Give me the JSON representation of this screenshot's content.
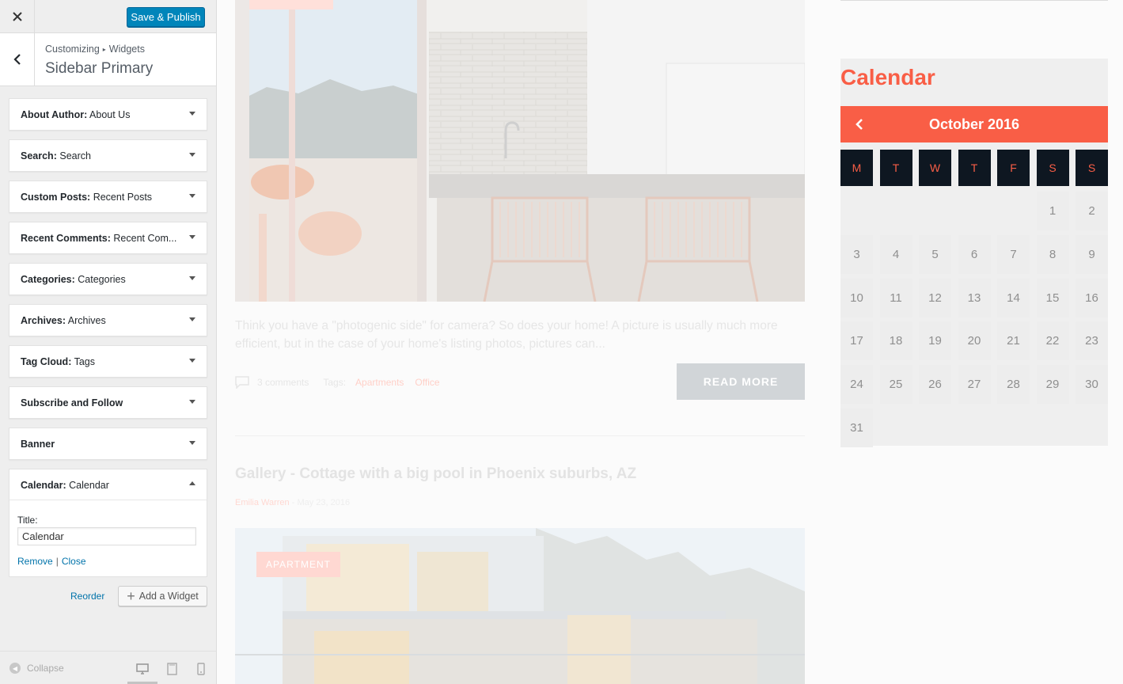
{
  "customizer": {
    "save_label": "Save & Publish",
    "breadcrumb": [
      "Customizing",
      "Widgets"
    ],
    "section_title": "Sidebar Primary",
    "widgets": [
      {
        "name": "About Author",
        "title": "About Us"
      },
      {
        "name": "Search",
        "title": "Search"
      },
      {
        "name": "Custom Posts",
        "title": "Recent Posts"
      },
      {
        "name": "Recent Comments",
        "title": "Recent Com..."
      },
      {
        "name": "Categories",
        "title": "Categories"
      },
      {
        "name": "Archives",
        "title": "Archives"
      },
      {
        "name": "Tag Cloud",
        "title": "Tags"
      },
      {
        "name": "Subscribe and Follow",
        "title": ""
      },
      {
        "name": "Banner",
        "title": ""
      },
      {
        "name": "Calendar",
        "title": "Calendar"
      }
    ],
    "open_widget": {
      "field_label": "Title:",
      "field_value": "Calendar",
      "remove_label": "Remove",
      "close_label": "Close"
    },
    "reorder_label": "Reorder",
    "add_widget_label": "Add a Widget",
    "collapse_label": "Collapse",
    "icons": [
      "close-icon",
      "back-arrow-icon",
      "chevron-down-icon",
      "chevron-up-icon",
      "plus-icon",
      "collapse-icon",
      "desktop-icon",
      "tablet-icon",
      "mobile-icon"
    ]
  },
  "preview": {
    "post1": {
      "excerpt": "Think you have a \"photogenic side\" for camera? So does your home! A picture is usually much more efficient, but in the case of your home's listing photos, pictures can...",
      "comments": "3 comments",
      "tags_label": "Tags:",
      "tags": [
        "Apartments",
        "Office"
      ],
      "read_more": "READ MORE"
    },
    "post2": {
      "title": "Gallery - Cottage with a big pool in Phoenix suburbs, AZ",
      "author": "Emilia Warren",
      "separator": "-",
      "date": "May 23, 2016",
      "badge": "APARTMENT"
    },
    "calendar": {
      "heading": "Calendar",
      "month": "October 2016",
      "day_headers": [
        "M",
        "T",
        "W",
        "T",
        "F",
        "S",
        "S"
      ],
      "first_weekday_index": 5,
      "days": [
        "1",
        "2",
        "3",
        "4",
        "5",
        "6",
        "7",
        "8",
        "9",
        "10",
        "11",
        "12",
        "13",
        "14",
        "15",
        "16",
        "17",
        "18",
        "19",
        "20",
        "21",
        "22",
        "23",
        "24",
        "25",
        "26",
        "27",
        "28",
        "29",
        "30",
        "31"
      ]
    },
    "colors": {
      "accent": "#f95e46",
      "dark": "#0e1721",
      "wp_blue": "#0085ba"
    }
  }
}
